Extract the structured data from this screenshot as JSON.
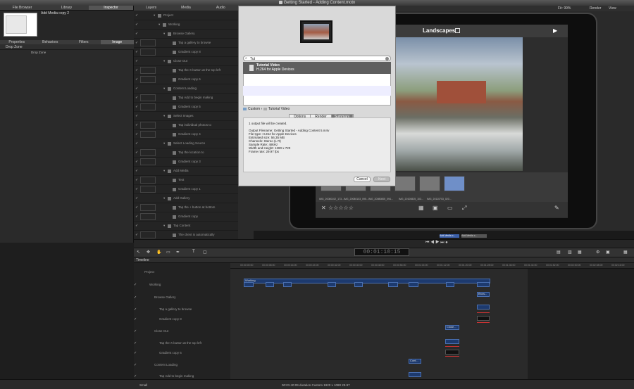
{
  "window": {
    "title": "Getting Started - Adding Content.motn"
  },
  "left_tabs": [
    "File Browser",
    "Library",
    "Inspector"
  ],
  "preview": {
    "name": "Add Media copy 2"
  },
  "inspector_tabs": [
    "Properties",
    "Behaviors",
    "Filters",
    "Image"
  ],
  "dropzone": {
    "label": "Drop Zone",
    "button": "Drop Zone"
  },
  "mid_tabs": [
    "Layers",
    "Media",
    "Audio"
  ],
  "canvas_top": {
    "fit": "Fit: 99%",
    "render": "Render",
    "view": "View"
  },
  "layers": [
    {
      "label": "Project",
      "indent": 0
    },
    {
      "label": "Working",
      "indent": 1
    },
    {
      "label": "Browse Gallery",
      "indent": 2
    },
    {
      "label": "Tap a gallery to browse",
      "indent": 3
    },
    {
      "label": "Gradient copy 8",
      "indent": 3
    },
    {
      "label": "Close Out",
      "indent": 2
    },
    {
      "label": "Tap the X button at the top left",
      "indent": 3
    },
    {
      "label": "Gradient copy 6",
      "indent": 3
    },
    {
      "label": "Content Loading",
      "indent": 2
    },
    {
      "label": "Tap Add to begin making",
      "indent": 3
    },
    {
      "label": "Gradient copy 5",
      "indent": 3
    },
    {
      "label": "Select Images",
      "indent": 2
    },
    {
      "label": "Tap individual photos to",
      "indent": 3
    },
    {
      "label": "Gradient copy 4",
      "indent": 3
    },
    {
      "label": "Select Loading Source",
      "indent": 2
    },
    {
      "label": "Tap the location to",
      "indent": 3
    },
    {
      "label": "Gradient copy 3",
      "indent": 3
    },
    {
      "label": "Add Media",
      "indent": 2
    },
    {
      "label": "Text",
      "indent": 3
    },
    {
      "label": "Gradient copy 1",
      "indent": 3
    },
    {
      "label": "Add Gallery",
      "indent": 2
    },
    {
      "label": "Tap the + button at bottom",
      "indent": 3
    },
    {
      "label": "Gradient copy",
      "indent": 3
    },
    {
      "label": "Tap Content",
      "indent": 2
    },
    {
      "label": "The client is automatically",
      "indent": 3
    }
  ],
  "ipad": {
    "title": "Landscapes",
    "thumb_labels": [
      "IMG_20080102_173...",
      "IMG_20080103_095...",
      "IMG_20080805_094...",
      "IMG_20100825_103...",
      "IMG_20110703_020..."
    ]
  },
  "dialog": {
    "search_value": "Tut",
    "list_item_title": "Tutorial Video",
    "list_item_subtitle": "H.264 for Apple Devices",
    "breadcrumb_root": "Custom",
    "breadcrumb_sep": "›",
    "breadcrumb_leaf": "Tutorial Video",
    "tabs": [
      "Options",
      "Render",
      "Summary"
    ],
    "summary_lines": [
      "1 output file will be created.",
      "",
      "Output Filename: Getting Started - Adding Content 5.m4v",
      "File type: H.264 for Apple Devices",
      "Estimated size: 56.35 MB",
      "Channels: Stereo (L R)",
      "Sample Rate: 48kHz",
      "Width and Height: 1280 x 720",
      "Frame rate: 29.97 fps"
    ],
    "cancel": "Cancel",
    "next": "Next"
  },
  "mini_timeline": {
    "clip": "Add Media c...",
    "clip2": "Add Media c..."
  },
  "timecode": "00:01:10:15",
  "timeline": {
    "title": "Timeline",
    "ruler": [
      "00:00:00:00",
      "00:00:08:00",
      "00:00:16:00",
      "00:00:24:00",
      "00:00:32:00",
      "00:00:40:00",
      "00:00:48:00",
      "00:00:56:00",
      "00:01:04:00",
      "00:01:12:00",
      "00:01:20:00",
      "00:01:28:00",
      "00:01:36:00",
      "00:01:44:00",
      "00:01:52:00",
      "00:02:00:00",
      "00:02:08:00",
      "00:02:16:00"
    ],
    "rows": [
      "Project",
      "Working",
      "Browse Gallery",
      "Tap a gallery to browse",
      "Gradient copy 8",
      "Close Out",
      "Tap the X button at the top left",
      "Gradient copy 6",
      "Content Loading",
      "Tap Add to begin making"
    ],
    "clip_working": "Working",
    "clip_browse": "Brow...",
    "clip_close": "Close...",
    "clip_cont": "Cont..."
  },
  "status": {
    "text": "00:01:40:09 duration Custom 1920 x 1080 29.97",
    "small": "Small"
  }
}
